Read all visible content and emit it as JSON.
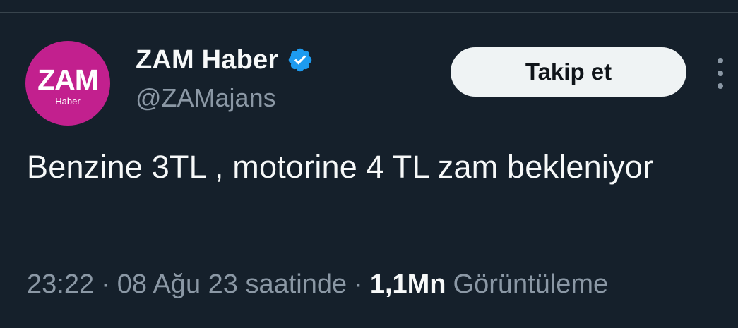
{
  "author": {
    "avatar": {
      "main_text": "ZAM",
      "sub_text": "Haber",
      "background": "#c2208e"
    },
    "display_name": "ZAM Haber",
    "handle": "@ZAMajans",
    "verified_icon": "verified-badge-icon",
    "verified_color": "#1d9bf0"
  },
  "actions": {
    "follow_label": "Takip et",
    "more_icon": "more-vertical-icon"
  },
  "tweet": {
    "text": "Benzine 3TL , motorine 4 TL zam bekleniyor"
  },
  "meta": {
    "time": "23:22",
    "date_text": "08 Ağu 23 saatinde",
    "views_count": "1,1Mn",
    "views_label": "Görüntüleme",
    "separator": "·"
  },
  "colors": {
    "background": "#15202b",
    "text_primary": "#f7f9f9",
    "text_secondary": "#8b98a5",
    "button_bg": "#eff3f4"
  }
}
